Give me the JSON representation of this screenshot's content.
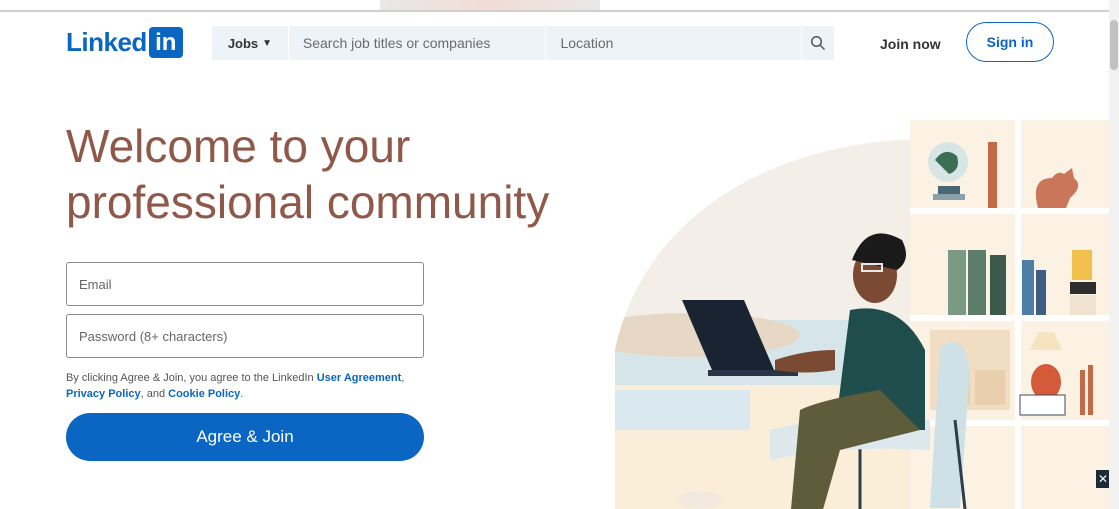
{
  "header": {
    "logo_text": "Linked",
    "logo_box": "in",
    "search": {
      "jobs_label": "Jobs",
      "keyword_placeholder": "Search job titles or companies",
      "location_placeholder": "Location"
    },
    "join_now": "Join now",
    "sign_in": "Sign in"
  },
  "hero": {
    "headline_line1": "Welcome to your",
    "headline_line2": "professional community"
  },
  "form": {
    "email_placeholder": "Email",
    "password_placeholder": "Password (8+ characters)",
    "agree_prefix": "By clicking Agree & Join, you agree to the LinkedIn ",
    "user_agreement": "User Agreement",
    "comma": ", ",
    "privacy_policy": "Privacy Policy",
    "and_text": ", and ",
    "cookie_policy": "Cookie Policy",
    "period": ".",
    "join_button": "Agree & Join"
  },
  "colors": {
    "brand": "#0a66c2",
    "headline": "#8f5849"
  },
  "icons": [
    "search-icon",
    "caret-down-icon"
  ]
}
